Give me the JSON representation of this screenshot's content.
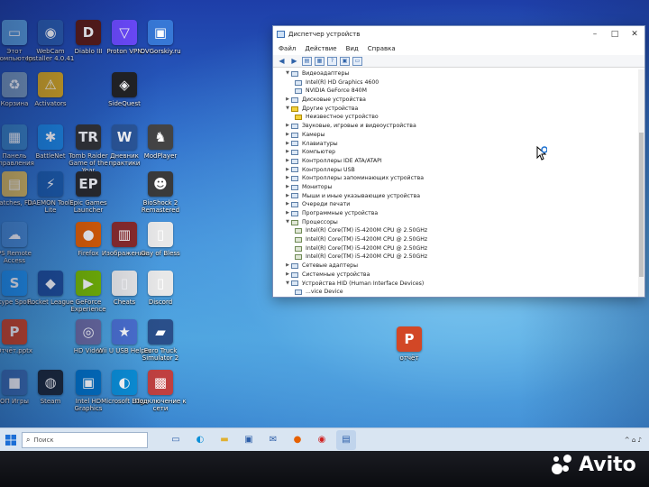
{
  "desktop": {
    "icons": [
      {
        "label": "Этот компьютер",
        "glyph": "▭",
        "color": "#5aa0e0"
      },
      {
        "label": "WebCam Installer 4.0.41",
        "glyph": "◉",
        "color": "#2a5db0"
      },
      {
        "label": "Diablo III",
        "glyph": "D",
        "color": "#5a1a14"
      },
      {
        "label": "Proton VPN",
        "glyph": "▽",
        "color": "#6d4aff"
      },
      {
        "label": "OVGorskiy.ru",
        "glyph": "▣",
        "color": "#3778d6"
      },
      {
        "label": "Корзина",
        "glyph": "♻",
        "color": "#7a9cc0"
      },
      {
        "label": "Activators",
        "glyph": "⚠",
        "color": "#d8a820"
      },
      {
        "label": "SideQuest",
        "glyph": "◈",
        "color": "#222222"
      },
      {
        "label": "Панель управления",
        "glyph": "▦",
        "color": "#3a86c8"
      },
      {
        "label": "BattleNet",
        "glyph": "✱",
        "color": "#1d88e5"
      },
      {
        "label": "Tomb Raider Game of the Year",
        "glyph": "TR",
        "color": "#333333"
      },
      {
        "label": "Дневник практики",
        "glyph": "W",
        "color": "#2b579a"
      },
      {
        "label": "ModPlayer",
        "glyph": "♞",
        "color": "#444444"
      },
      {
        "label": "Patches, Fix",
        "glyph": "▤",
        "color": "#e0c060"
      },
      {
        "label": "DAEMON Tools Lite",
        "glyph": "⚡",
        "color": "#1c5fb0"
      },
      {
        "label": "Epic Games Launcher",
        "glyph": "EP",
        "color": "#2a2a2a"
      },
      {
        "label": "BioShock 2 Remastered",
        "glyph": "☻",
        "color": "#3a3a3a"
      },
      {
        "label": "PS Remote Access",
        "glyph": "☁",
        "color": "#4a90d9"
      },
      {
        "label": "Firefox",
        "glyph": "●",
        "color": "#e66000"
      },
      {
        "label": "Изображения",
        "glyph": "▥",
        "color": "#8b2a2a"
      },
      {
        "label": "Gay of Bless",
        "glyph": "▯",
        "color": "#e8e8e8"
      },
      {
        "label": "Skype Spoti..",
        "glyph": "S",
        "color": "#2196f3"
      },
      {
        "label": "Rocket League",
        "glyph": "◆",
        "color": "#1e4f9c"
      },
      {
        "label": "GeForce Experience",
        "glyph": "▶",
        "color": "#76b900"
      },
      {
        "label": "Cheats",
        "glyph": "▯",
        "color": "#e8e8e8"
      },
      {
        "label": "Discord",
        "glyph": "▯",
        "color": "#e8e8e8"
      },
      {
        "label": "Отчёт.pptx",
        "glyph": "P",
        "color": "#d24726"
      },
      {
        "label": "HD Video",
        "glyph": "◎",
        "color": "#6a6aa0"
      },
      {
        "label": "Wii U USB Helper",
        "glyph": "★",
        "color": "#4a6fd0"
      },
      {
        "label": "Euro Truck Simulator 2",
        "glyph": "▰",
        "color": "#2a4f8a"
      },
      {
        "label": "ОП Игры",
        "glyph": "■",
        "color": "#3a6fb4"
      },
      {
        "label": "Steam",
        "glyph": "◍",
        "color": "#1b2838"
      },
      {
        "label": "Intel HD Graphics",
        "glyph": "▣",
        "color": "#0071c5"
      },
      {
        "label": "Microsoft Edge",
        "glyph": "◐",
        "color": "#0a8fd8"
      },
      {
        "label": "Подключение к сети",
        "glyph": "▩",
        "color": "#c04040"
      },
      {
        "label": "отчёт",
        "glyph": "P",
        "color": "#d24726"
      }
    ]
  },
  "window": {
    "title": "Диспетчер устройств",
    "controls": {
      "minimize": "–",
      "maximize": "□",
      "close": "✕"
    },
    "menu": [
      "Файл",
      "Действие",
      "Вид",
      "Справка"
    ],
    "tree": [
      {
        "label": "Видеоадаптеры",
        "level": 1,
        "expanded": true,
        "icon": "monitor"
      },
      {
        "label": "Intel(R) HD Graphics 4600",
        "level": 2,
        "icon": "monitor"
      },
      {
        "label": "NVIDIA GeForce 840M",
        "level": 2,
        "icon": "monitor"
      },
      {
        "label": "Дисковые устройства",
        "level": 1,
        "expanded": false,
        "icon": "disk"
      },
      {
        "label": "Другие устройства",
        "level": 1,
        "expanded": true,
        "icon": "warn"
      },
      {
        "label": "Неизвестное устройство",
        "level": 2,
        "icon": "warn"
      },
      {
        "label": "Звуковые, игровые и видеоустройства",
        "level": 1,
        "expanded": false,
        "icon": "sound"
      },
      {
        "label": "Камеры",
        "level": 1,
        "expanded": false,
        "icon": "camera"
      },
      {
        "label": "Клавиатуры",
        "level": 1,
        "expanded": false,
        "icon": "keyboard"
      },
      {
        "label": "Компьютер",
        "level": 1,
        "expanded": false,
        "icon": "computer"
      },
      {
        "label": "Контроллеры IDE ATA/ATAPI",
        "level": 1,
        "expanded": false,
        "icon": "ide"
      },
      {
        "label": "Контроллеры USB",
        "level": 1,
        "expanded": false,
        "icon": "usb"
      },
      {
        "label": "Контроллеры запоминающих устройства",
        "level": 1,
        "expanded": false,
        "icon": "storage"
      },
      {
        "label": "Мониторы",
        "level": 1,
        "expanded": false,
        "icon": "monitor"
      },
      {
        "label": "Мыши и иные указывающие устройства",
        "level": 1,
        "expanded": false,
        "icon": "mouse"
      },
      {
        "label": "Очереди печати",
        "level": 1,
        "expanded": false,
        "icon": "printer"
      },
      {
        "label": "Программные устройства",
        "level": 1,
        "expanded": false,
        "icon": "software"
      },
      {
        "label": "Процессоры",
        "level": 1,
        "expanded": true,
        "icon": "cpu"
      },
      {
        "label": "Intel(R) Core(TM) i5-4200M CPU @ 2.50GHz",
        "level": 2,
        "icon": "cpu"
      },
      {
        "label": "Intel(R) Core(TM) i5-4200M CPU @ 2.50GHz",
        "level": 2,
        "icon": "cpu"
      },
      {
        "label": "Intel(R) Core(TM) i5-4200M CPU @ 2.50GHz",
        "level": 2,
        "icon": "cpu"
      },
      {
        "label": "Intel(R) Core(TM) i5-4200M CPU @ 2.50GHz",
        "level": 2,
        "icon": "cpu"
      },
      {
        "label": "Сетевые адаптеры",
        "level": 1,
        "expanded": false,
        "icon": "network"
      },
      {
        "label": "Системные устройства",
        "level": 1,
        "expanded": false,
        "icon": "system"
      },
      {
        "label": "Устройства HID (Human Interface Devices)",
        "level": 1,
        "expanded": true,
        "icon": "hid"
      },
      {
        "label": "...vice Device",
        "level": 2,
        "icon": "hid"
      }
    ]
  },
  "taskbar": {
    "search_placeholder": "Поиск",
    "apps": [
      "task-view",
      "edge",
      "explorer",
      "store",
      "mail",
      "firefox",
      "yandex",
      "device-manager"
    ],
    "tray": "^ ⌂ ♪"
  },
  "watermark": {
    "text": "Avito"
  }
}
